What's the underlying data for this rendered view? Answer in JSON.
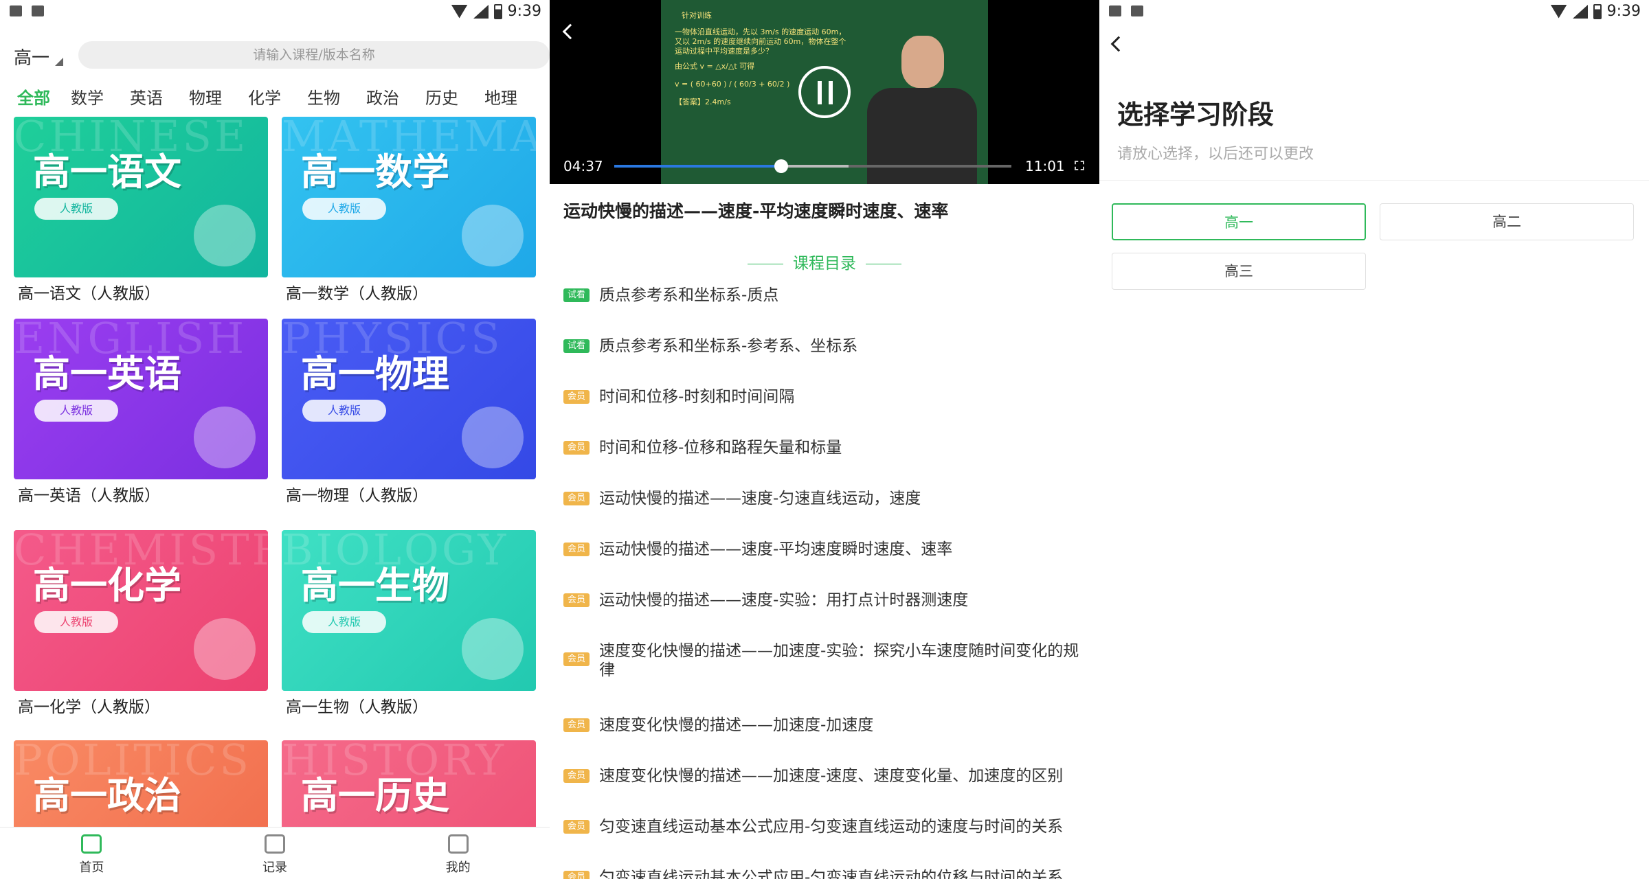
{
  "status_bar": {
    "time": "9:39"
  },
  "home": {
    "grade_selector": "高一",
    "search": {
      "placeholder": "请输入课程/版本名称"
    },
    "subject_tabs": [
      "全部",
      "数学",
      "英语",
      "物理",
      "化学",
      "生物",
      "政治",
      "历史",
      "地理"
    ],
    "active_tab_color": "#2fb95a",
    "courses": [
      {
        "title": "高一语文",
        "edition": "人教版",
        "caption": "高一语文（人教版）",
        "bg_word": "CHINESE",
        "color_from": "#1fcf9a",
        "color_to": "#12b59e",
        "icon": "star-book-icon"
      },
      {
        "title": "高一数学",
        "edition": "人教版",
        "caption": "高一数学（人教版）",
        "bg_word": "MATHEMATICS",
        "color_from": "#33c3f0",
        "color_to": "#1fa8e8",
        "icon": "calendar-math-icon"
      },
      {
        "title": "高一英语",
        "edition": "人教版",
        "caption": "高一英语（人教版）",
        "bg_word": "ENGLISH",
        "color_from": "#9b3ef0",
        "color_to": "#7a2fe0",
        "icon": "abc-blocks-icon"
      },
      {
        "title": "高一物理",
        "edition": "人教版",
        "caption": "高一物理（人教版）",
        "bg_word": "PHYSICS",
        "color_from": "#4a5cf5",
        "color_to": "#3449e6",
        "icon": "magnet-icon"
      },
      {
        "title": "高一化学",
        "edition": "人教版",
        "caption": "高一化学（人教版）",
        "bg_word": "CHEMISTRY",
        "color_from": "#f45a8a",
        "color_to": "#ec4270",
        "icon": "robot-icon"
      },
      {
        "title": "高一生物",
        "edition": "人教版",
        "caption": "高一生物（人教版）",
        "bg_word": "BIOLOGY",
        "color_from": "#3fe0c4",
        "color_to": "#22c9b0",
        "icon": "microscope-icon"
      },
      {
        "title": "高一政治",
        "edition": "",
        "caption": "",
        "bg_word": "POLITICS",
        "color_from": "#f98a64",
        "color_to": "#f06a4a",
        "icon": ""
      },
      {
        "title": "高一历史",
        "edition": "",
        "caption": "",
        "bg_word": "HISTORY",
        "color_from": "#f56a8a",
        "color_to": "#ee4f74",
        "icon": ""
      }
    ],
    "bottom_nav": [
      {
        "label": "首页",
        "icon": "home-icon"
      },
      {
        "label": "记录",
        "icon": "record-icon"
      },
      {
        "label": "我的",
        "icon": "profile-icon"
      }
    ]
  },
  "player": {
    "board_lines": [
      "针对训练",
      "一物体沿直线运动，先以 3m/s 的速度运动 60m，",
      "又以 2m/s 的速度继续向前运动 60m，物体在整个",
      "运动过程中平均速度是多少？",
      "由公式 v = △x/△t 可得",
      "v = ( 60+60 ) / ( 60/3 + 60/2 )",
      "【答案】2.4m/s"
    ],
    "current_time": "04:37",
    "total_time": "11:01",
    "progress": 0.42,
    "buffered": 0.59,
    "lesson_title": "运动快慢的描述——速度-平均速度瞬时速度、速率",
    "catalog_heading": "课程目录",
    "lessons": [
      {
        "badge": "试看",
        "type": "trial",
        "title": "质点参考系和坐标系-质点"
      },
      {
        "badge": "试看",
        "type": "trial",
        "title": "质点参考系和坐标系-参考系、坐标系"
      },
      {
        "badge": "会员",
        "type": "member",
        "title": "时间和位移-时刻和时间间隔"
      },
      {
        "badge": "会员",
        "type": "member",
        "title": "时间和位移-位移和路程矢量和标量"
      },
      {
        "badge": "会员",
        "type": "member",
        "title": "运动快慢的描述——速度-匀速直线运动，速度"
      },
      {
        "badge": "会员",
        "type": "member",
        "title": "运动快慢的描述——速度-平均速度瞬时速度、速率"
      },
      {
        "badge": "会员",
        "type": "member",
        "title": "运动快慢的描述——速度-实验：用打点计时器测速度"
      },
      {
        "badge": "会员",
        "type": "member",
        "title": "速度变化快慢的描述——加速度-实验：探究小车速度随时间变化的规律"
      },
      {
        "badge": "会员",
        "type": "member",
        "title": "速度变化快慢的描述——加速度-加速度"
      },
      {
        "badge": "会员",
        "type": "member",
        "title": "速度变化快慢的描述——加速度-速度、速度变化量、加速度的区别"
      },
      {
        "badge": "会员",
        "type": "member",
        "title": "匀变速直线运动基本公式应用-匀变速直线运动的速度与时间的关系"
      },
      {
        "badge": "会员",
        "type": "member",
        "title": "匀变速直线运动基本公式应用-匀变速直线运动的位移与时间的关系"
      }
    ]
  },
  "stage_select": {
    "title": "选择学习阶段",
    "subtitle": "请放心选择，以后还可以更改",
    "options": [
      {
        "label": "高一",
        "selected": true
      },
      {
        "label": "高二",
        "selected": false
      },
      {
        "label": "高三",
        "selected": false
      }
    ]
  }
}
